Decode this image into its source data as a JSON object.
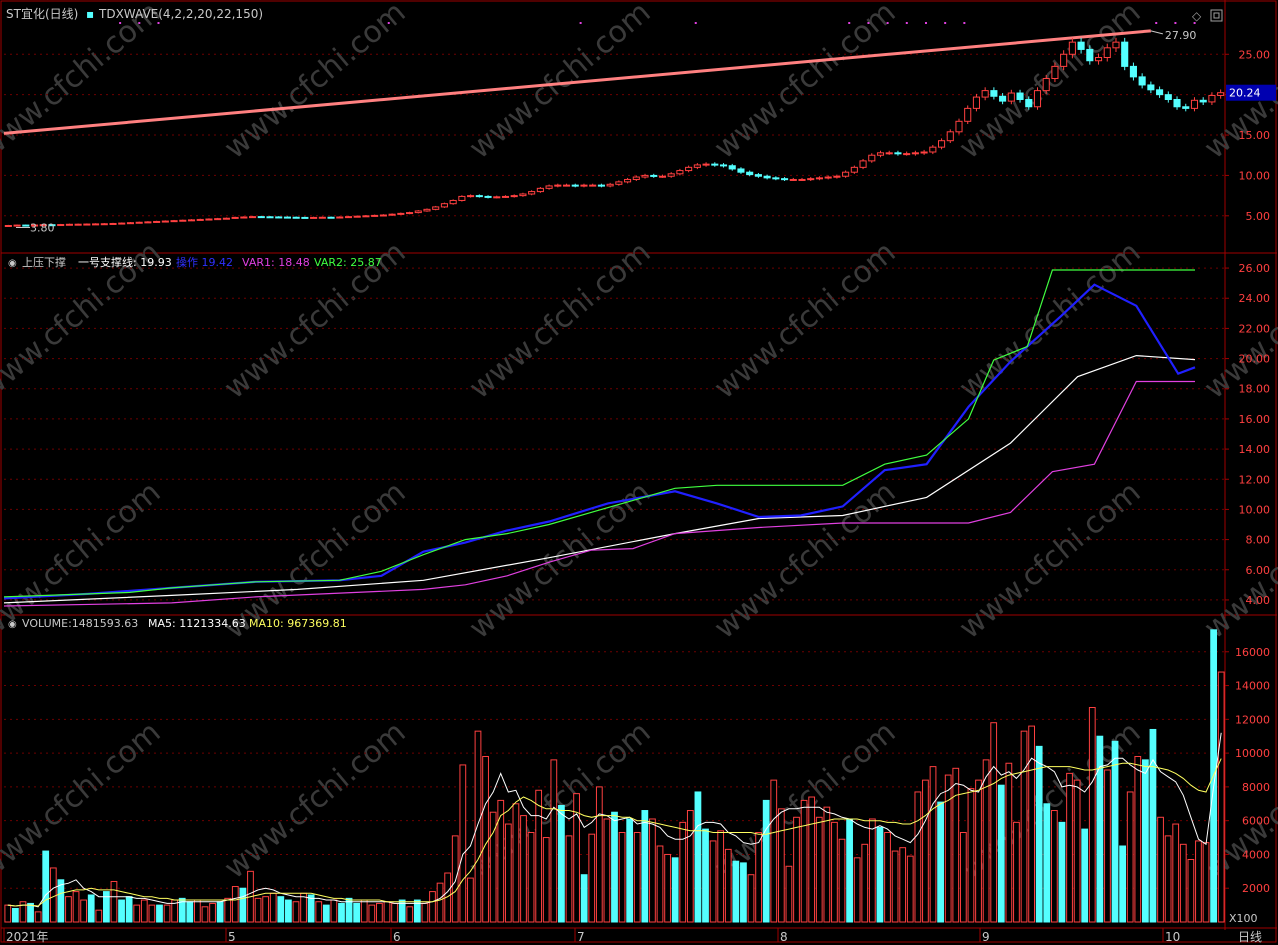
{
  "top": {
    "title": "ST宜化(日线)",
    "indicator": "TDXWAVE(4,2,2,20,22,150)",
    "high_label": "27.90",
    "low_label": "3.80",
    "price_tag": "20.24"
  },
  "mid": {
    "name": "上压下撑",
    "items": [
      {
        "label": "一号支撑线:",
        "value": "19.93",
        "color": "#ffffff"
      },
      {
        "label": "操作",
        "value": "19.42",
        "color": "#2020ff"
      },
      {
        "label": "VAR1:",
        "value": "18.48",
        "color": "#e040e0"
      },
      {
        "label": "VAR2:",
        "value": "25.87",
        "color": "#40ff40"
      }
    ]
  },
  "vol": {
    "name": "VOLUME:",
    "value": "1481593.63",
    "ma5_label": "MA5:",
    "ma5": "1121334.63",
    "ma10_label": "MA10:",
    "ma10": "967369.81",
    "unit": "X100"
  },
  "xaxis": {
    "labels": [
      "2021年",
      "5",
      "6",
      "7",
      "8",
      "9",
      "10"
    ],
    "period": "日线"
  },
  "watermark": "www.cfchi.com",
  "colors": {
    "up": "#ff4040",
    "down": "#54ffff",
    "grid": "#6e0000",
    "frame": "#a00000",
    "trend": "#ff8080"
  },
  "chart_data": [
    {
      "type": "candlestick",
      "title": "ST宜化(日线)",
      "y_ticks": [
        5.0,
        10.0,
        15.0,
        20.0,
        25.0
      ],
      "ylim": [
        2.5,
        28.5
      ],
      "annotations": {
        "high": 27.9,
        "low": 3.8,
        "last": 20.24
      },
      "trend_line": {
        "from": 15.2,
        "to": 27.9
      },
      "close": [
        3.8,
        3.85,
        3.82,
        3.86,
        3.9,
        3.88,
        3.92,
        3.95,
        3.96,
        3.98,
        4.0,
        4.02,
        4.05,
        4.1,
        4.15,
        4.2,
        4.25,
        4.3,
        4.35,
        4.4,
        4.45,
        4.5,
        4.55,
        4.6,
        4.65,
        4.7,
        4.8,
        4.85,
        4.9,
        4.88,
        4.86,
        4.84,
        4.82,
        4.8,
        4.78,
        4.8,
        4.82,
        4.8,
        4.85,
        4.9,
        4.95,
        5.0,
        5.05,
        5.1,
        5.2,
        5.3,
        5.4,
        5.6,
        5.8,
        6.1,
        6.5,
        6.9,
        7.4,
        7.5,
        7.4,
        7.3,
        7.35,
        7.4,
        7.5,
        7.7,
        8.0,
        8.4,
        8.7,
        8.8,
        8.8,
        8.7,
        8.8,
        8.8,
        8.7,
        8.9,
        9.2,
        9.5,
        9.8,
        10.0,
        9.9,
        9.9,
        10.2,
        10.6,
        11.0,
        11.3,
        11.4,
        11.3,
        11.2,
        10.8,
        10.4,
        10.1,
        9.9,
        9.7,
        9.6,
        9.5,
        9.5,
        9.5,
        9.6,
        9.7,
        9.8,
        9.9,
        10.4,
        11.0,
        11.8,
        12.5,
        12.8,
        12.8,
        12.7,
        12.7,
        12.8,
        12.9,
        13.5,
        14.3,
        15.4,
        16.7,
        18.3,
        19.7,
        20.5,
        19.8,
        19.2,
        20.2,
        19.4,
        18.5,
        20.5,
        22.0,
        23.5,
        25.0,
        26.5,
        25.6,
        24.2,
        24.6,
        25.8,
        26.5,
        23.5,
        22.2,
        21.2,
        20.6,
        20.0,
        19.4,
        18.5,
        18.3,
        19.3,
        19.1,
        19.9,
        20.24
      ]
    },
    {
      "type": "line",
      "title": "上压下撑",
      "y_ticks": [
        4.0,
        6.0,
        8.0,
        10.0,
        12.0,
        14.0,
        16.0,
        18.0,
        20.0,
        22.0,
        24.0,
        26.0
      ],
      "ylim": [
        3.2,
        26.8
      ],
      "series": [
        {
          "name": "一号支撑线",
          "color": "#ffffff",
          "x": [
            0,
            20,
            35,
            50,
            65,
            80,
            90,
            100,
            110,
            120,
            128,
            135,
            142
          ],
          "values": [
            3.8,
            4.3,
            4.7,
            5.3,
            6.8,
            8.4,
            9.4,
            9.6,
            10.8,
            14.4,
            18.8,
            20.2,
            19.93
          ]
        },
        {
          "name": "操作",
          "color": "#2020ff",
          "x": [
            0,
            10,
            20,
            30,
            40,
            45,
            50,
            55,
            60,
            65,
            72,
            80,
            85,
            90,
            95,
            100,
            105,
            110,
            115,
            120,
            126,
            130,
            135,
            140,
            142
          ],
          "values": [
            4.1,
            4.4,
            4.8,
            5.2,
            5.3,
            5.6,
            7.2,
            7.8,
            8.6,
            9.2,
            10.4,
            11.2,
            10.4,
            9.5,
            9.6,
            10.2,
            12.6,
            13.0,
            16.8,
            19.8,
            22.8,
            24.9,
            23.5,
            19.0,
            19.42
          ]
        },
        {
          "name": "VAR1",
          "color": "#e040e0",
          "x": [
            0,
            20,
            30,
            50,
            55,
            60,
            65,
            70,
            75,
            80,
            90,
            100,
            108,
            115,
            120,
            125,
            130,
            135,
            142
          ],
          "values": [
            3.6,
            3.8,
            4.2,
            4.7,
            5.0,
            5.6,
            6.5,
            7.3,
            7.4,
            8.4,
            8.8,
            9.1,
            9.1,
            9.1,
            9.8,
            12.5,
            13.0,
            18.48,
            18.48
          ]
        },
        {
          "name": "VAR2",
          "color": "#40ff40",
          "x": [
            0,
            15,
            20,
            25,
            30,
            40,
            45,
            50,
            55,
            60,
            65,
            70,
            75,
            80,
            85,
            90,
            100,
            105,
            110,
            115,
            118,
            122,
            125,
            130,
            135,
            142
          ],
          "values": [
            4.2,
            4.5,
            4.8,
            5.0,
            5.2,
            5.3,
            5.9,
            7.0,
            8.0,
            8.4,
            9.0,
            9.8,
            10.6,
            11.4,
            11.6,
            11.6,
            11.6,
            13.0,
            13.6,
            16.0,
            19.9,
            20.8,
            25.87,
            25.87,
            25.87,
            25.87
          ]
        }
      ]
    },
    {
      "type": "bar",
      "title": "VOLUME",
      "unit": "X100",
      "y_ticks": [
        2000,
        4000,
        6000,
        8000,
        10000,
        12000,
        14000,
        16000
      ],
      "ylim": [
        0,
        18000
      ],
      "values": [
        1000,
        800,
        1200,
        1100,
        600,
        4200,
        3200,
        2500,
        1500,
        1800,
        1300,
        1600,
        700,
        1800,
        2400,
        1300,
        1500,
        1000,
        1300,
        1000,
        1000,
        1000,
        1300,
        1400,
        1200,
        1300,
        900,
        1100,
        1200,
        1400,
        2100,
        2000,
        3000,
        1400,
        1500,
        1700,
        1500,
        1300,
        1200,
        1700,
        1600,
        1200,
        1000,
        1300,
        1100,
        1400,
        1100,
        1300,
        1000,
        1100,
        1200,
        1100,
        1300,
        900,
        1300,
        1100,
        1800,
        2300,
        2900,
        5100,
        9300,
        2600,
        11300,
        9800,
        6500,
        7200,
        5800,
        7000,
        6300,
        5300,
        7800,
        5000,
        9600,
        6900,
        5100,
        7600,
        2800,
        5200,
        8000,
        6100,
        6500,
        5300,
        6100,
        5300,
        6600,
        6100,
        4500,
        4000,
        3800,
        5900,
        6600,
        7700,
        5500,
        4800,
        5400,
        4300,
        3600,
        3500,
        2800,
        5300,
        7200,
        8400,
        6700,
        3300,
        6200,
        7200,
        7400,
        6200,
        6800,
        5900,
        4900,
        6100,
        3800,
        4600,
        6100,
        5600,
        5300,
        4200,
        4400,
        3900,
        7700,
        8400,
        9200,
        7100,
        8700,
        9100,
        5300,
        7900,
        8400,
        9600,
        11800,
        8100,
        9400,
        5900,
        11300,
        11600,
        10400,
        7000,
        6600,
        5900,
        8800,
        8400,
        5500,
        12700,
        11000,
        9000,
        10700,
        4500,
        7700,
        9800,
        9600,
        11400,
        6200,
        5100,
        5800,
        4600,
        3700,
        4800,
        4700,
        17300,
        14800
      ],
      "up": [
        1,
        0,
        1,
        0,
        1,
        0,
        1,
        0,
        1,
        1,
        1,
        0,
        1,
        0,
        1,
        0,
        0,
        1,
        1,
        1,
        0,
        1,
        1,
        0,
        0,
        1,
        1,
        1,
        0,
        1,
        1,
        0,
        1,
        1,
        1,
        1,
        0,
        0,
        1,
        1,
        0,
        1,
        0,
        1,
        0,
        0,
        0,
        1,
        1,
        1,
        1,
        1,
        0,
        1,
        0,
        1,
        1,
        1,
        1,
        1,
        1,
        1,
        1,
        1,
        1,
        1,
        1,
        1,
        1,
        1,
        1,
        1,
        1,
        0,
        1,
        1,
        0,
        1,
        1,
        1,
        0,
        1,
        0,
        1,
        0,
        1,
        1,
        1,
        0,
        1,
        1,
        0,
        0,
        1,
        1,
        1,
        0,
        0,
        1,
        1,
        0,
        1,
        1,
        1,
        1,
        1,
        1,
        1,
        1,
        1,
        1,
        0,
        1,
        1,
        1,
        0,
        1,
        1,
        1,
        1,
        1,
        1,
        1,
        0,
        1,
        1,
        1,
        1,
        1,
        1,
        1,
        0,
        1,
        1,
        1,
        1,
        0,
        0,
        1,
        0,
        1,
        1,
        0,
        1,
        0,
        1,
        0,
        0,
        1,
        1,
        0,
        0,
        1,
        1,
        1,
        1,
        1,
        1,
        1,
        0,
        1,
        1
      ],
      "ma5": [
        1000,
        950,
        1000,
        1000,
        900,
        1600,
        2000,
        2200,
        2300,
        2500,
        2000,
        1800,
        1500,
        1500,
        1500,
        1500,
        1500,
        1400,
        1400,
        1300,
        1200,
        1100,
        1100,
        1200,
        1200,
        1200,
        1200,
        1200,
        1200,
        1300,
        1400,
        1500,
        1700,
        1900,
        2000,
        1900,
        1700,
        1600,
        1500,
        1500,
        1400,
        1400,
        1300,
        1300,
        1200,
        1200,
        1200,
        1200,
        1200,
        1200,
        1200,
        1100,
        1100,
        1100,
        1100,
        1100,
        1200,
        1400,
        1800,
        2400,
        4000,
        4500,
        5800,
        7000,
        7700,
        8800,
        7700,
        7800,
        6800,
        6300,
        6300,
        6100,
        6800,
        6400,
        6100,
        6400,
        5600,
        5900,
        6400,
        6300,
        6000,
        6100,
        6200,
        5800,
        5900,
        5800,
        5600,
        5100,
        4900,
        4900,
        5100,
        5700,
        5900,
        5900,
        5800,
        5300,
        5100,
        4700,
        4600,
        4700,
        5500,
        6100,
        6500,
        6700,
        6700,
        6800,
        6800,
        6800,
        6500,
        6400,
        6200,
        6100,
        5800,
        5600,
        5500,
        5700,
        5500,
        5100,
        4900,
        4700,
        5200,
        6000,
        7000,
        7600,
        7800,
        8200,
        8100,
        7800,
        7700,
        8600,
        9200,
        8700,
        8900,
        8500,
        9000,
        9700,
        9400,
        9200,
        8900,
        8000,
        8100,
        8000,
        7700,
        8300,
        9200,
        9300,
        9700,
        9700,
        9300,
        9000,
        8800,
        9600,
        8900,
        8600,
        8300,
        7500,
        6200,
        4900,
        4600,
        8000,
        11200
      ],
      "ma10": [
        1000,
        950,
        1000,
        1000,
        950,
        1300,
        1500,
        1700,
        1800,
        1900,
        1900,
        2000,
        1900,
        1900,
        1900,
        1800,
        1700,
        1600,
        1500,
        1500,
        1400,
        1400,
        1300,
        1300,
        1300,
        1300,
        1300,
        1300,
        1300,
        1300,
        1300,
        1400,
        1500,
        1600,
        1700,
        1700,
        1700,
        1700,
        1700,
        1700,
        1700,
        1600,
        1500,
        1400,
        1400,
        1300,
        1300,
        1300,
        1300,
        1300,
        1200,
        1200,
        1200,
        1200,
        1200,
        1200,
        1200,
        1300,
        1500,
        1800,
        2500,
        3000,
        3700,
        4600,
        5300,
        6300,
        6600,
        7100,
        7400,
        7200,
        6900,
        6700,
        6700,
        6600,
        6600,
        6500,
        6300,
        6200,
        6300,
        6300,
        6300,
        6200,
        6200,
        6000,
        6000,
        5900,
        5800,
        5700,
        5600,
        5500,
        5400,
        5400,
        5400,
        5300,
        5300,
        5300,
        5300,
        5300,
        5300,
        5200,
        5200,
        5300,
        5400,
        5500,
        5600,
        5700,
        5800,
        5900,
        6000,
        6100,
        6100,
        6100,
        6100,
        6000,
        6000,
        6000,
        5900,
        5900,
        5800,
        5800,
        6000,
        6300,
        6700,
        7000,
        7200,
        7500,
        7600,
        7700,
        7800,
        8000,
        8200,
        8500,
        8700,
        8800,
        8900,
        9000,
        9100,
        9200,
        9200,
        9200,
        9200,
        9100,
        9000,
        9000,
        9100,
        9200,
        9300,
        9400,
        9400,
        9300,
        9200,
        9200,
        9100,
        9000,
        8800,
        8500,
        8100,
        7800,
        7700,
        8700,
        9673
      ]
    }
  ]
}
